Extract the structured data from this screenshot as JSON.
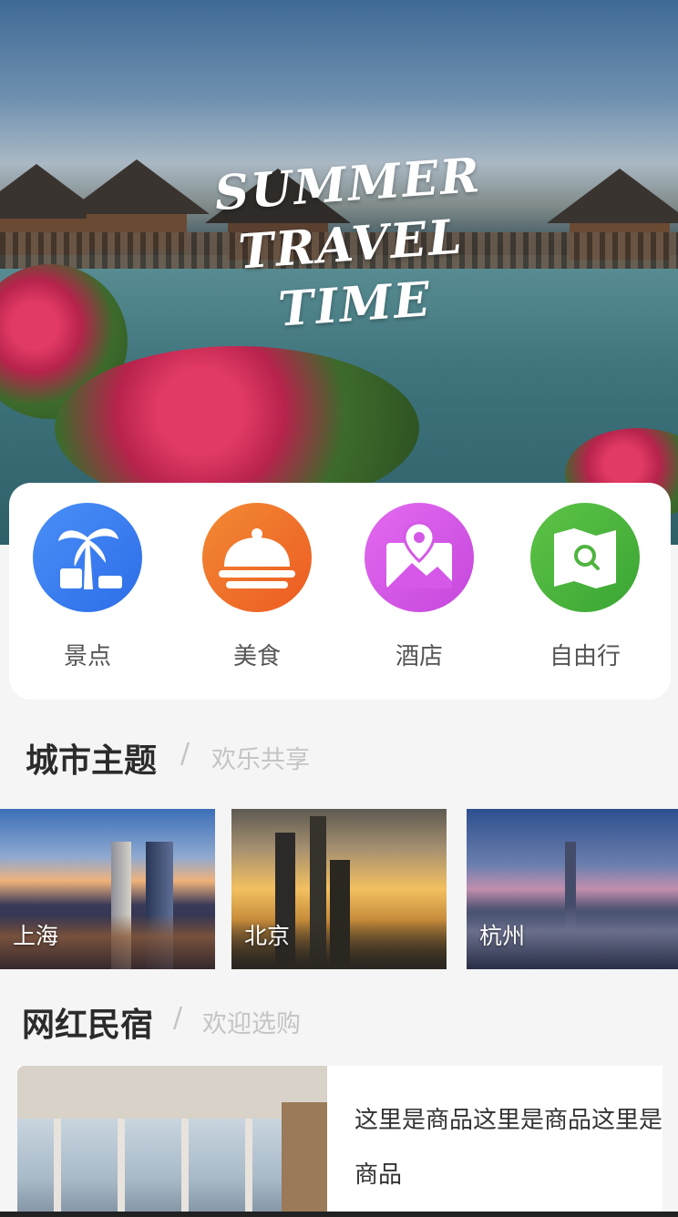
{
  "hero": {
    "title_lines": [
      "SUMMER",
      "TRAVEL",
      "TIME"
    ]
  },
  "categories": [
    {
      "label": "景点",
      "icon": "palm-tree-icon",
      "color": "#3b7ff2"
    },
    {
      "label": "美食",
      "icon": "food-dome-icon",
      "color": "#f0712c"
    },
    {
      "label": "酒店",
      "icon": "map-pin-icon",
      "color": "#d558e8"
    },
    {
      "label": "自由行",
      "icon": "map-search-icon",
      "color": "#4fb43f"
    }
  ],
  "city_section": {
    "title": "城市主题",
    "separator": "/",
    "subtitle": "欢乐共享"
  },
  "cities": [
    {
      "name": "上海"
    },
    {
      "name": "北京"
    },
    {
      "name": "杭州"
    }
  ],
  "homestay_section": {
    "title": "网红民宿",
    "separator": "/",
    "subtitle": "欢迎选购"
  },
  "product": {
    "description": "这里是商品这里是商品这里是商品"
  }
}
